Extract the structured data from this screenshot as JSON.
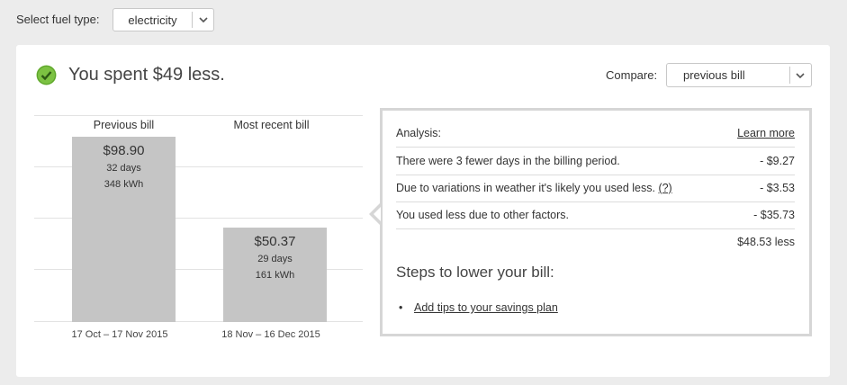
{
  "fuel": {
    "label": "Select fuel type:",
    "value": "electricity"
  },
  "summary": {
    "headline": "You spent $49 less."
  },
  "compare": {
    "label": "Compare:",
    "value": "previous bill"
  },
  "chart_data": {
    "type": "bar",
    "categories": [
      "Previous bill",
      "Most recent bill"
    ],
    "values": [
      98.9,
      50.37
    ],
    "ylim": [
      0,
      110
    ],
    "bars": [
      {
        "title": "Previous bill",
        "amount": "$98.90",
        "days": "32 days",
        "kwh": "348 kWh",
        "period": "17 Oct – 17 Nov 2015"
      },
      {
        "title": "Most recent bill",
        "amount": "$50.37",
        "days": "29 days",
        "kwh": "161 kWh",
        "period": "18 Nov – 16 Dec 2015"
      }
    ],
    "gridlines": 4
  },
  "analysis": {
    "title": "Analysis:",
    "learn_more": "Learn more",
    "rows": [
      {
        "text": "There were 3 fewer days in the billing period.",
        "value": "- $9.27"
      },
      {
        "text": "Due to variations in weather it's likely you used less.",
        "help": "(?)",
        "value": "- $3.53"
      },
      {
        "text": "You used less due to other factors.",
        "value": "- $35.73"
      }
    ],
    "total": "$48.53 less",
    "steps_title": "Steps to lower your bill:",
    "tip_link": "Add tips to your savings plan"
  },
  "colors": {
    "bar": "#c5c5c5",
    "check": "#7cc242",
    "border": "#d6d6d6"
  }
}
